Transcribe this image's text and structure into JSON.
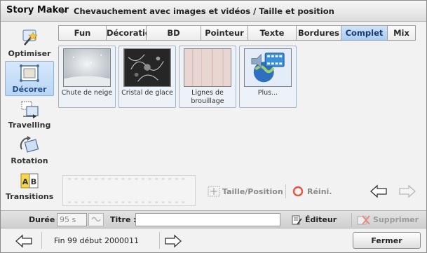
{
  "window": {
    "app_title": "Story Maker",
    "breadcrumb": "Chevauchement avec images et vidéos / Taille et position"
  },
  "sidebar": {
    "items": [
      {
        "label": "Optimiser",
        "icon": "wand-icon",
        "active": false
      },
      {
        "label": "Décorer",
        "icon": "frame-icon",
        "active": true
      },
      {
        "label": "Travelling",
        "icon": "travelling-icon",
        "active": false
      },
      {
        "label": "Rotation",
        "icon": "rotation-icon",
        "active": false
      },
      {
        "label": "Transitions",
        "icon": "ab-transition-icon",
        "active": false
      }
    ]
  },
  "tabs": [
    {
      "label": "Fun",
      "active": false
    },
    {
      "label": "Décoration",
      "active": false
    },
    {
      "label": "BD",
      "active": false
    },
    {
      "label": "Pointeur",
      "active": false
    },
    {
      "label": "Texte",
      "active": false
    },
    {
      "label": "Bordures",
      "active": false
    },
    {
      "label": "Complet",
      "active": true
    },
    {
      "label": "Mix",
      "active": false
    }
  ],
  "thumbnails": [
    {
      "label": "Chute de neige",
      "icon": "snowfall-thumbnail"
    },
    {
      "label": "Cristal de glace",
      "icon": "ice-crystal-thumbnail"
    },
    {
      "label": "Lignes de brouillage",
      "icon": "scrambled-lines-thumbnail"
    },
    {
      "label": "Plus...",
      "icon": "more-effects-icon"
    }
  ],
  "controls": {
    "size_position_label": "Taille/Position",
    "reset_label": "Réini."
  },
  "fields": {
    "duration_label": "Durée :",
    "duration_value": "95 s",
    "title_label": "Titre :",
    "title_value": "",
    "editor_label": "Éditeur",
    "delete_label": "Supprimer"
  },
  "footer": {
    "status": "Fin 99 début 2000011",
    "close_label": "Fermer"
  },
  "colors": {
    "active_tab": "#b9d5f4",
    "accent_blue": "#1f4f8f",
    "reset_red": "#e05a4a"
  }
}
